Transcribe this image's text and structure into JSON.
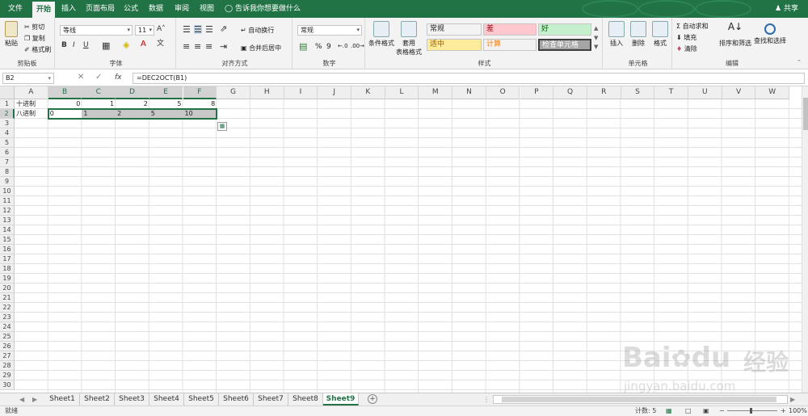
{
  "ribbon_tabs": [
    "文件",
    "开始",
    "插入",
    "页面布局",
    "公式",
    "数据",
    "审阅",
    "视图"
  ],
  "active_tab": "开始",
  "tell_me": "告诉我你想要做什么",
  "share": "共享",
  "clipboard": {
    "paste": "粘贴",
    "cut": "剪切",
    "copy": "复制",
    "format_painter": "格式刷",
    "label": "剪贴板"
  },
  "font": {
    "name": "等线",
    "size": "11",
    "bold": "B",
    "italic": "I",
    "underline": "U",
    "label": "字体"
  },
  "alignment": {
    "wrap": "自动换行",
    "merge": "合并后居中",
    "label": "对齐方式"
  },
  "number": {
    "format": "常规",
    "percent": "%",
    "comma": "9",
    "label": "数字"
  },
  "styles": {
    "conditional": "条件格式",
    "table_format_1": "套用",
    "table_format_2": "表格格式",
    "cells": [
      {
        "label": "常规",
        "bg": "#ffffff",
        "color": "#222222"
      },
      {
        "label": "差",
        "bg": "#ffc7ce",
        "color": "#9c0006"
      },
      {
        "label": "好",
        "bg": "#c6efce",
        "color": "#006100"
      },
      {
        "label": "适中",
        "bg": "#ffeb9c",
        "color": "#9c5700"
      },
      {
        "label": "计算",
        "bg": "#f2f2f2",
        "color": "#fa7d00"
      },
      {
        "label": "检查单元格",
        "bg": "#a5a5a5",
        "color": "#ffffff"
      }
    ],
    "label": "样式"
  },
  "cells_group": {
    "insert": "插入",
    "delete": "删除",
    "format": "格式",
    "label": "单元格"
  },
  "editing": {
    "autosum": "自动求和",
    "fill": "填充",
    "clear": "清除",
    "sort_filter": "排序和筛选",
    "find_select": "查找和选择",
    "label": "编辑"
  },
  "formula_bar": {
    "name_box": "B2",
    "fx": "fx",
    "formula": "=DEC2OCT(B1)"
  },
  "columns": [
    "A",
    "B",
    "C",
    "D",
    "E",
    "F",
    "G",
    "H",
    "I",
    "J",
    "K",
    "L",
    "M",
    "N",
    "O",
    "P",
    "Q",
    "R",
    "S",
    "T",
    "U",
    "V",
    "W"
  ],
  "rows": [
    "1",
    "2",
    "3",
    "4",
    "5",
    "6",
    "7",
    "8",
    "9",
    "10",
    "11",
    "12",
    "13",
    "14",
    "15",
    "16",
    "17",
    "18",
    "19",
    "20",
    "21",
    "22",
    "23",
    "24",
    "25",
    "26",
    "27",
    "28",
    "29",
    "30"
  ],
  "sheet": {
    "A1": "十进制",
    "B1": "0",
    "C1": "1",
    "D1": "2",
    "E1": "5",
    "F1": "8",
    "A2": "八进制",
    "B2": "0",
    "C2": "1",
    "D2": "2",
    "E2": "5",
    "F2": "10"
  },
  "sheet_tabs": [
    "Sheet1",
    "Sheet2",
    "Sheet3",
    "Sheet4",
    "Sheet5",
    "Sheet6",
    "Sheet7",
    "Sheet8",
    "Sheet9"
  ],
  "active_sheet": "Sheet9",
  "status": {
    "ready": "就绪",
    "count": "计数: 5",
    "zoom": "100%"
  },
  "watermark": {
    "brand": "Bai",
    "brand2": "du",
    "brand_cn": "经验",
    "url": "jingyan.baidu.com"
  }
}
